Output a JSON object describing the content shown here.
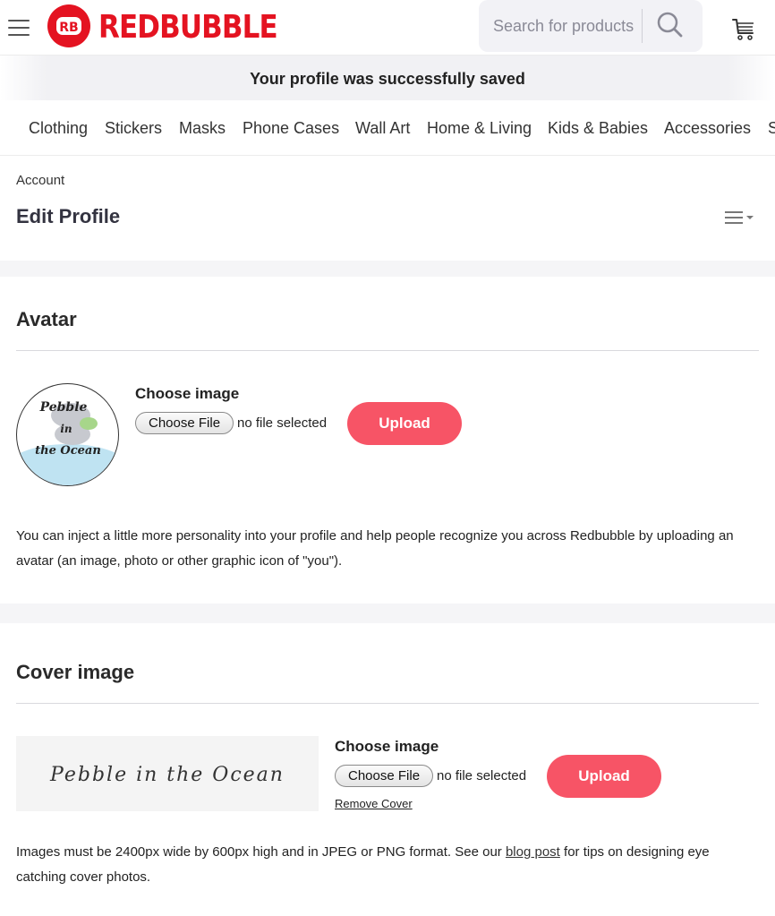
{
  "header": {
    "logo_text": "REDBUBBLE",
    "logo_mark": "RB",
    "search_placeholder": "Search for products",
    "brand_color": "#e41321"
  },
  "banner": {
    "message": "Your profile was successfully saved"
  },
  "categories": [
    "Clothing",
    "Stickers",
    "Masks",
    "Phone Cases",
    "Wall Art",
    "Home & Living",
    "Kids & Babies",
    "Accessories",
    "S"
  ],
  "account": {
    "breadcrumb": "Account",
    "title": "Edit Profile"
  },
  "avatar_section": {
    "title": "Avatar",
    "image_text": [
      "Pebble",
      "in",
      "the Ocean"
    ],
    "choose_label": "Choose image",
    "choose_file_button": "Choose File",
    "file_status": "no file selected",
    "upload_button": "Upload",
    "description": "You can inject a little more personality into your profile and help people recognize you across Redbubble by uploading an avatar (an image, photo or other graphic icon of \"you\")."
  },
  "cover_section": {
    "title": "Cover image",
    "image_text": "Pebble in the Ocean",
    "choose_label": "Choose image",
    "choose_file_button": "Choose File",
    "file_status": "no file selected",
    "upload_button": "Upload",
    "remove_link": "Remove Cover",
    "description_before": "Images must be 2400px wide by 600px high and in JPEG or PNG format. See our ",
    "description_link": "blog post",
    "description_after": " for tips on designing eye catching cover photos."
  },
  "colors": {
    "upload_button": "#f75466",
    "text": "#222222"
  }
}
